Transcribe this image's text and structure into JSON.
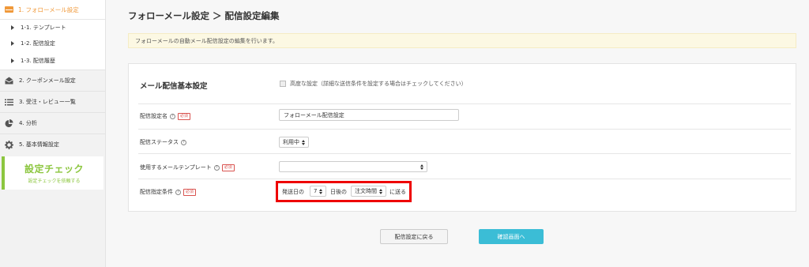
{
  "sidebar": {
    "active_label": "1. フォローメール設定",
    "subitems": [
      "1-1. テンプレート",
      "1-2. 配信設定",
      "1-3. 配信履歴"
    ],
    "items": [
      "2. クーポンメール設定",
      "3. 受注・レビュー一覧",
      "4. 分析",
      "5. 基本情報設定"
    ],
    "check_title": "設定チェック",
    "check_sub": "設定チェックを依頼する"
  },
  "header": {
    "title": "フォローメール設定 ＞ 配信設定編集"
  },
  "notice": "フォローメールの自動メール配信設定の編集を行います。",
  "form": {
    "section_title": "メール配信基本設定",
    "advanced_label": "高度な設定（詳細な送信条件を設定する場合はチェックしてください）",
    "name_label": "配信設定名",
    "name_value": "フォローメール配信設定",
    "status_label": "配信ステータス",
    "status_value": "利用中",
    "template_label": "使用するメールテンプレート",
    "template_value": "",
    "condition_label": "配信指定条件",
    "required": "必須",
    "help": "?",
    "cond_prefix": "発送日の",
    "cond_days": "7",
    "cond_mid": "日後の",
    "cond_time": "注文時間",
    "cond_suffix": "に送る"
  },
  "buttons": {
    "back": "配信設定に戻る",
    "confirm": "確認画面へ"
  },
  "colors": {
    "accent_orange": "#f0993a",
    "check_green": "#8cc63f",
    "confirm_blue": "#3bbdd6",
    "highlight_red": "#e00000"
  }
}
